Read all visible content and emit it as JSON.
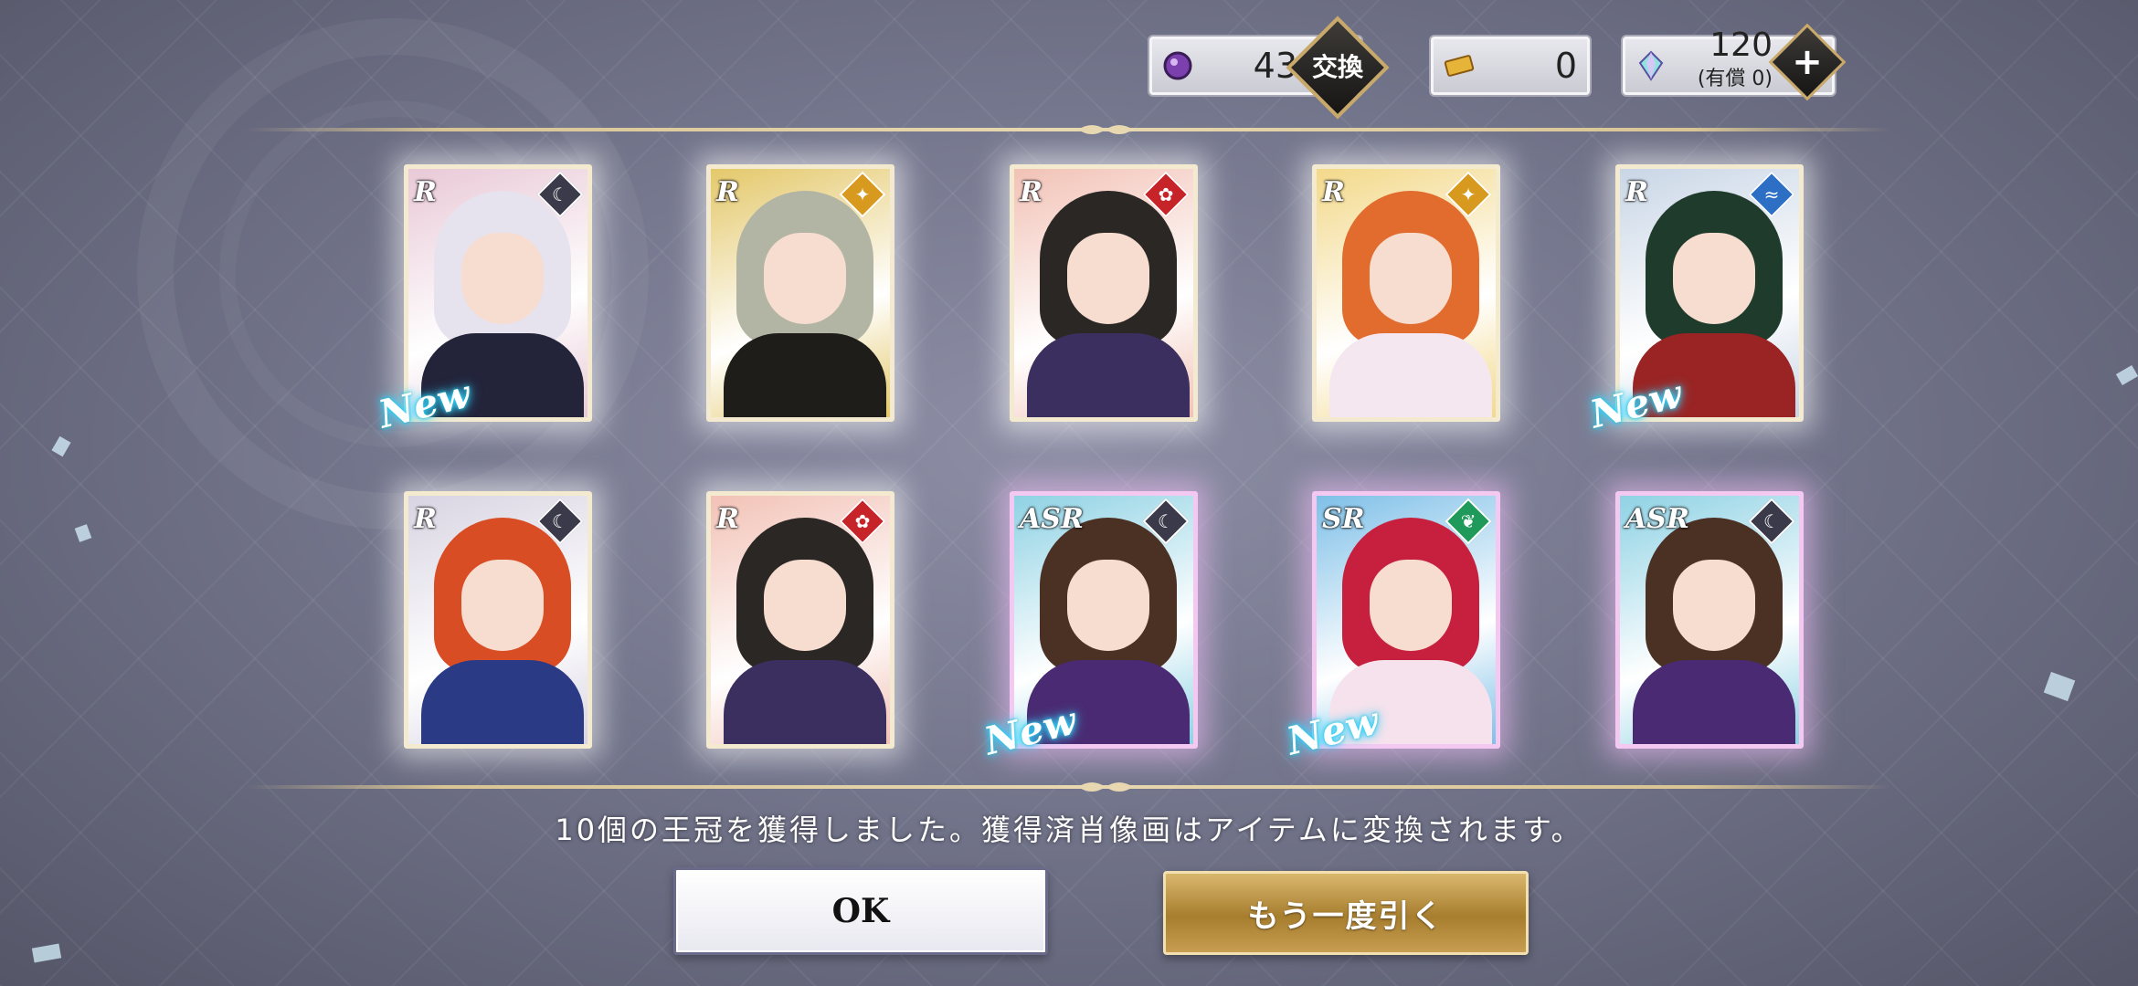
{
  "currency": {
    "orbs": "43",
    "exchange_label": "交換",
    "tickets": "0",
    "gems": "120",
    "gems_paid": "(有償 0)",
    "add_label": "+"
  },
  "cards": [
    {
      "rarity": "R",
      "attribute": "moon",
      "attr_color": "#3a3a4a",
      "new": "New",
      "hair": "#e6e2ee",
      "outfit": "#23233a",
      "bg": "#e9c9d7"
    },
    {
      "rarity": "R",
      "attribute": "star",
      "attr_color": "#d89a1e",
      "new": "",
      "hair": "#b2b5a4",
      "outfit": "#1e1d19",
      "bg": "#e4c86a"
    },
    {
      "rarity": "R",
      "attribute": "flower",
      "attr_color": "#c7242a",
      "new": "",
      "hair": "#2a2724",
      "outfit": "#3a2f5e",
      "bg": "#f2c2b6"
    },
    {
      "rarity": "R",
      "attribute": "star",
      "attr_color": "#d89a1e",
      "new": "",
      "hair": "#e26b2e",
      "outfit": "#f5e7f0",
      "bg": "#f3d98a"
    },
    {
      "rarity": "R",
      "attribute": "wave",
      "attr_color": "#2d6fc4",
      "new": "New",
      "hair": "#1f3b2c",
      "outfit": "#9a2323",
      "bg": "#c9d6e6"
    },
    {
      "rarity": "R",
      "attribute": "moon",
      "attr_color": "#3a3a4a",
      "new": "",
      "hair": "#d84d24",
      "outfit": "#2b3a85",
      "bg": "#d8d4e2"
    },
    {
      "rarity": "R",
      "attribute": "flower",
      "attr_color": "#c7242a",
      "new": "",
      "hair": "#2a2724",
      "outfit": "#3a2f5e",
      "bg": "#f2c2b6"
    },
    {
      "rarity": "ASR",
      "attribute": "moon",
      "attr_color": "#3a3a4a",
      "new": "New",
      "hair": "#4b3024",
      "outfit": "#4a2a72",
      "bg": "#8fd2e4"
    },
    {
      "rarity": "SR",
      "attribute": "leaf",
      "attr_color": "#1f9a5a",
      "new": "New",
      "hair": "#c6203e",
      "outfit": "#f6e2ec",
      "bg": "#7fc0e8"
    },
    {
      "rarity": "ASR",
      "attribute": "moon",
      "attr_color": "#3a3a4a",
      "new": "",
      "hair": "#4b3024",
      "outfit": "#4a2a72",
      "bg": "#8fd2e4"
    }
  ],
  "message": "10個の王冠を獲得しました。獲得済肖像画はアイテムに変換されます。",
  "buttons": {
    "ok": "OK",
    "again": "もう一度引く"
  }
}
